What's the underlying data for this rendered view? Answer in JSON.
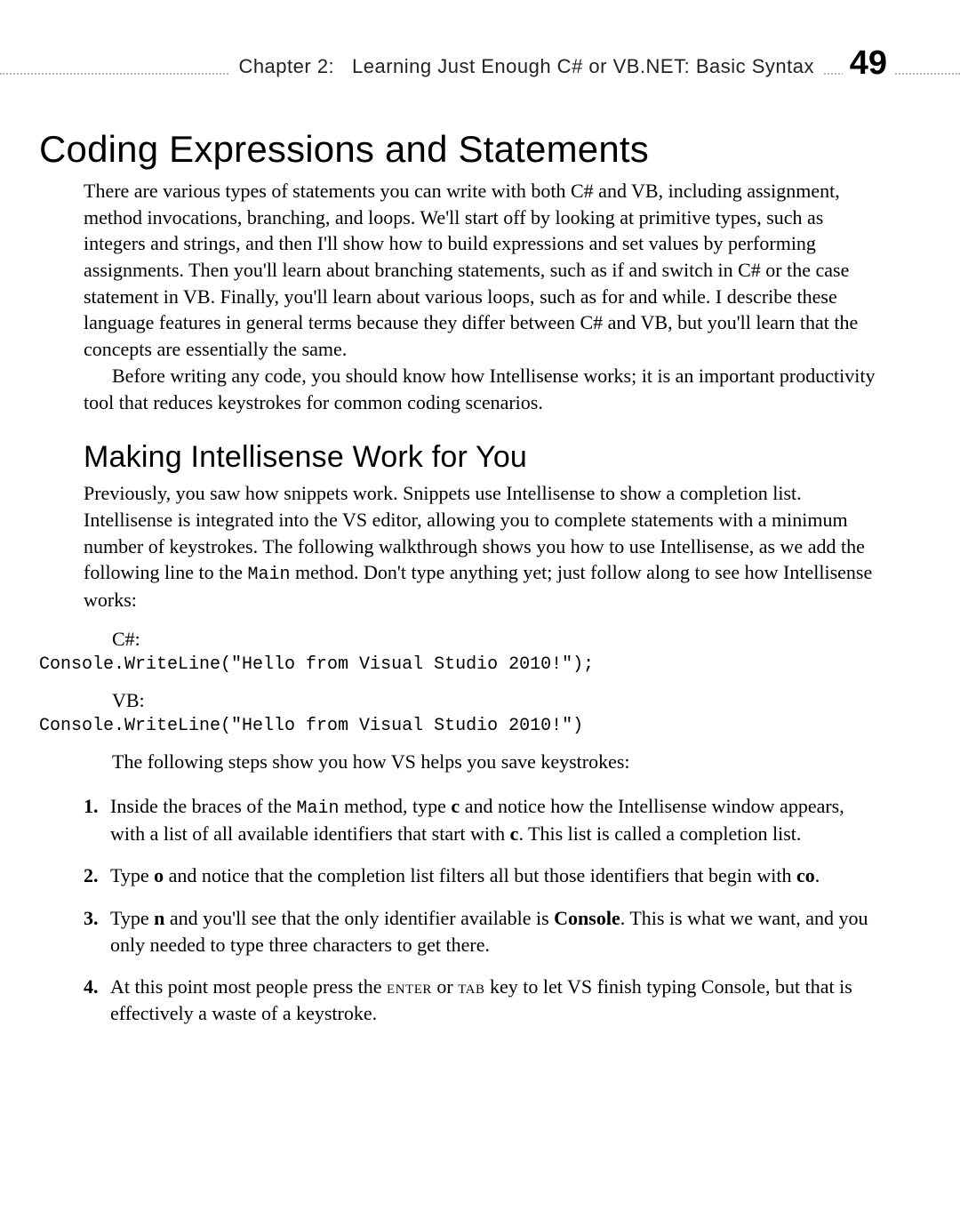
{
  "running_head": {
    "chapter_label": "Chapter 2:",
    "chapter_title": "Learning Just Enough C# or VB.NET: Basic Syntax",
    "page_number": "49"
  },
  "section_title": "Coding Expressions and Statements",
  "intro_p1": "There are various types of statements you can write with both C# and VB, including assignment, method invocations, branching, and loops. We'll start off by looking at primitive types, such as integers and strings, and then I'll show how to build expressions and set values by performing assignments. Then you'll learn about branching statements, such as if and switch in C# or the case statement in VB. Finally, you'll learn about various loops, such as for and while. I describe these language features in general terms because they differ between C# and VB, but you'll learn that the concepts are essentially the same.",
  "intro_p2": "Before writing any code, you should know how Intellisense works; it is an important productivity tool that reduces keystrokes for common coding scenarios.",
  "subsection_title": "Making Intellisense Work for You",
  "sub_p1_a": "Previously, you saw how snippets work. Snippets use Intellisense to show a completion list. Intellisense is integrated into the VS editor, allowing you to complete statements with a minimum number of keystrokes. The following walkthrough shows you how to use Intellisense, as we add the following line to the ",
  "main_method": "Main",
  "sub_p1_b": " method. Don't type anything yet; just follow along to see how Intellisense works:",
  "csharp_label": "C#:",
  "csharp_code": "Console.WriteLine(\"Hello from Visual Studio 2010!\");",
  "vb_label": "VB:",
  "vb_code": "Console.WriteLine(\"Hello from Visual Studio 2010!\")",
  "steps_intro": "The following steps show you how VS helps you save keystrokes:",
  "steps": {
    "s1": {
      "num": "1.",
      "a": "Inside the braces of the ",
      "b": " method, type ",
      "c_key": "c",
      "d": " and notice how the Intellisense window appears, with a list of all available identifiers that start with ",
      "c_key2": "c",
      "e": ". This list is called a completion list."
    },
    "s2": {
      "num": "2.",
      "a": "Type ",
      "o_key": "o",
      "b": " and notice that the completion list filters all but those identifiers that begin with ",
      "co_key": "co",
      "c": "."
    },
    "s3": {
      "num": "3.",
      "a": "Type ",
      "n_key": "n",
      "b": " and you'll see that the only identifier available is ",
      "console": "Console",
      "c": ". This is what we want, and you only needed to type three characters to get there."
    },
    "s4": {
      "num": "4.",
      "a": "At this point most people press the ",
      "enter": "enter",
      "b": " or ",
      "tab": "tab",
      "c": " key to let VS finish typing Console, but that is effectively a waste of a keystroke."
    }
  }
}
